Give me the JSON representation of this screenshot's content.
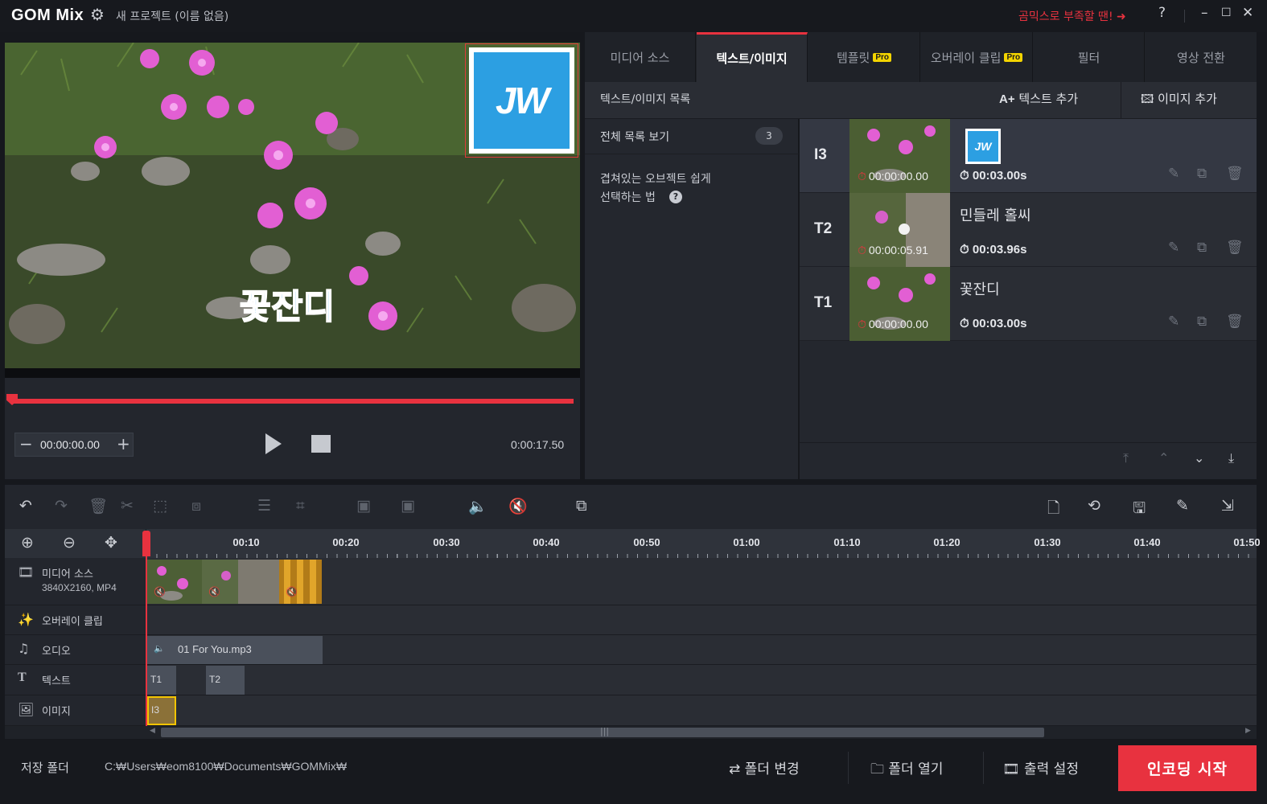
{
  "titlebar": {
    "logo": "GOM Mix",
    "project_title": "새 프로젝트 (이름 없음)",
    "promo_text": "곰믹스로 부족할 땐!",
    "help_label": "?",
    "icons": [
      "gear-icon",
      "minimize-icon",
      "maximize-icon",
      "close-icon"
    ]
  },
  "preview": {
    "overlay_text": "꽃잔디",
    "overlay_logo_text": "JW"
  },
  "player": {
    "current_time": "00:00:00.00",
    "total_time": "0:00:17.50",
    "minus": "−",
    "plus": "+",
    "progress": 0.0
  },
  "tabs": [
    {
      "label": "미디어 소스",
      "pro": false,
      "active": false
    },
    {
      "label": "텍스트/이미지",
      "pro": false,
      "active": true
    },
    {
      "label": "템플릿",
      "pro": true,
      "active": false
    },
    {
      "label": "오버레이 클립",
      "pro": true,
      "active": false
    },
    {
      "label": "필터",
      "pro": false,
      "active": false
    },
    {
      "label": "영상 전환",
      "pro": false,
      "active": false
    }
  ],
  "pro_badge": "Pro",
  "list": {
    "title": "텍스트/이미지 목록",
    "add_text": "텍스트 추가",
    "add_image": "이미지 추가",
    "all_list_label": "전체 목록 보기",
    "all_list_count": "3",
    "tip_line1": "겹쳐있는 오브젝트 쉽게",
    "tip_line2": "선택하는 법",
    "items": [
      {
        "id": "I3",
        "start": "00:00:00.00",
        "duration": "00:03.00s",
        "name": "",
        "type": "image"
      },
      {
        "id": "T2",
        "start": "00:00:05.91",
        "duration": "00:03.96s",
        "name": "민들레 홀씨",
        "type": "text"
      },
      {
        "id": "T1",
        "start": "00:00:00.00",
        "duration": "00:03.00s",
        "name": "꽃잔디",
        "type": "text"
      }
    ]
  },
  "timeline": {
    "ruler_labels": [
      "00:10",
      "00:20",
      "00:30",
      "00:40",
      "00:50",
      "01:00",
      "01:10",
      "01:20",
      "01:30",
      "01:40",
      "01:50"
    ],
    "tracks": {
      "media": {
        "name": "미디어 소스",
        "sub": "3840X2160, MP4"
      },
      "overlay": {
        "name": "오버레이 클립"
      },
      "audio": {
        "name": "오디오",
        "clip": "01 For You.mp3"
      },
      "text": {
        "name": "텍스트",
        "clips": [
          "T1",
          "T2"
        ]
      },
      "image": {
        "name": "이미지",
        "clips": [
          "I3"
        ]
      }
    }
  },
  "bottombar": {
    "save_folder_label": "저장 폴더",
    "save_folder_path": "C:₩Users₩eom8100₩Documents₩GOMMix₩",
    "change_folder": "폴더 변경",
    "open_folder": "폴더 열기",
    "output_settings": "출력 설정",
    "encode": "인코딩 시작"
  },
  "colors": {
    "accent": "#e8323f",
    "pro_badge": "#f3d400",
    "logo_blue": "#2c9fe2",
    "overlay_text_blue": "#1d9ef0"
  }
}
